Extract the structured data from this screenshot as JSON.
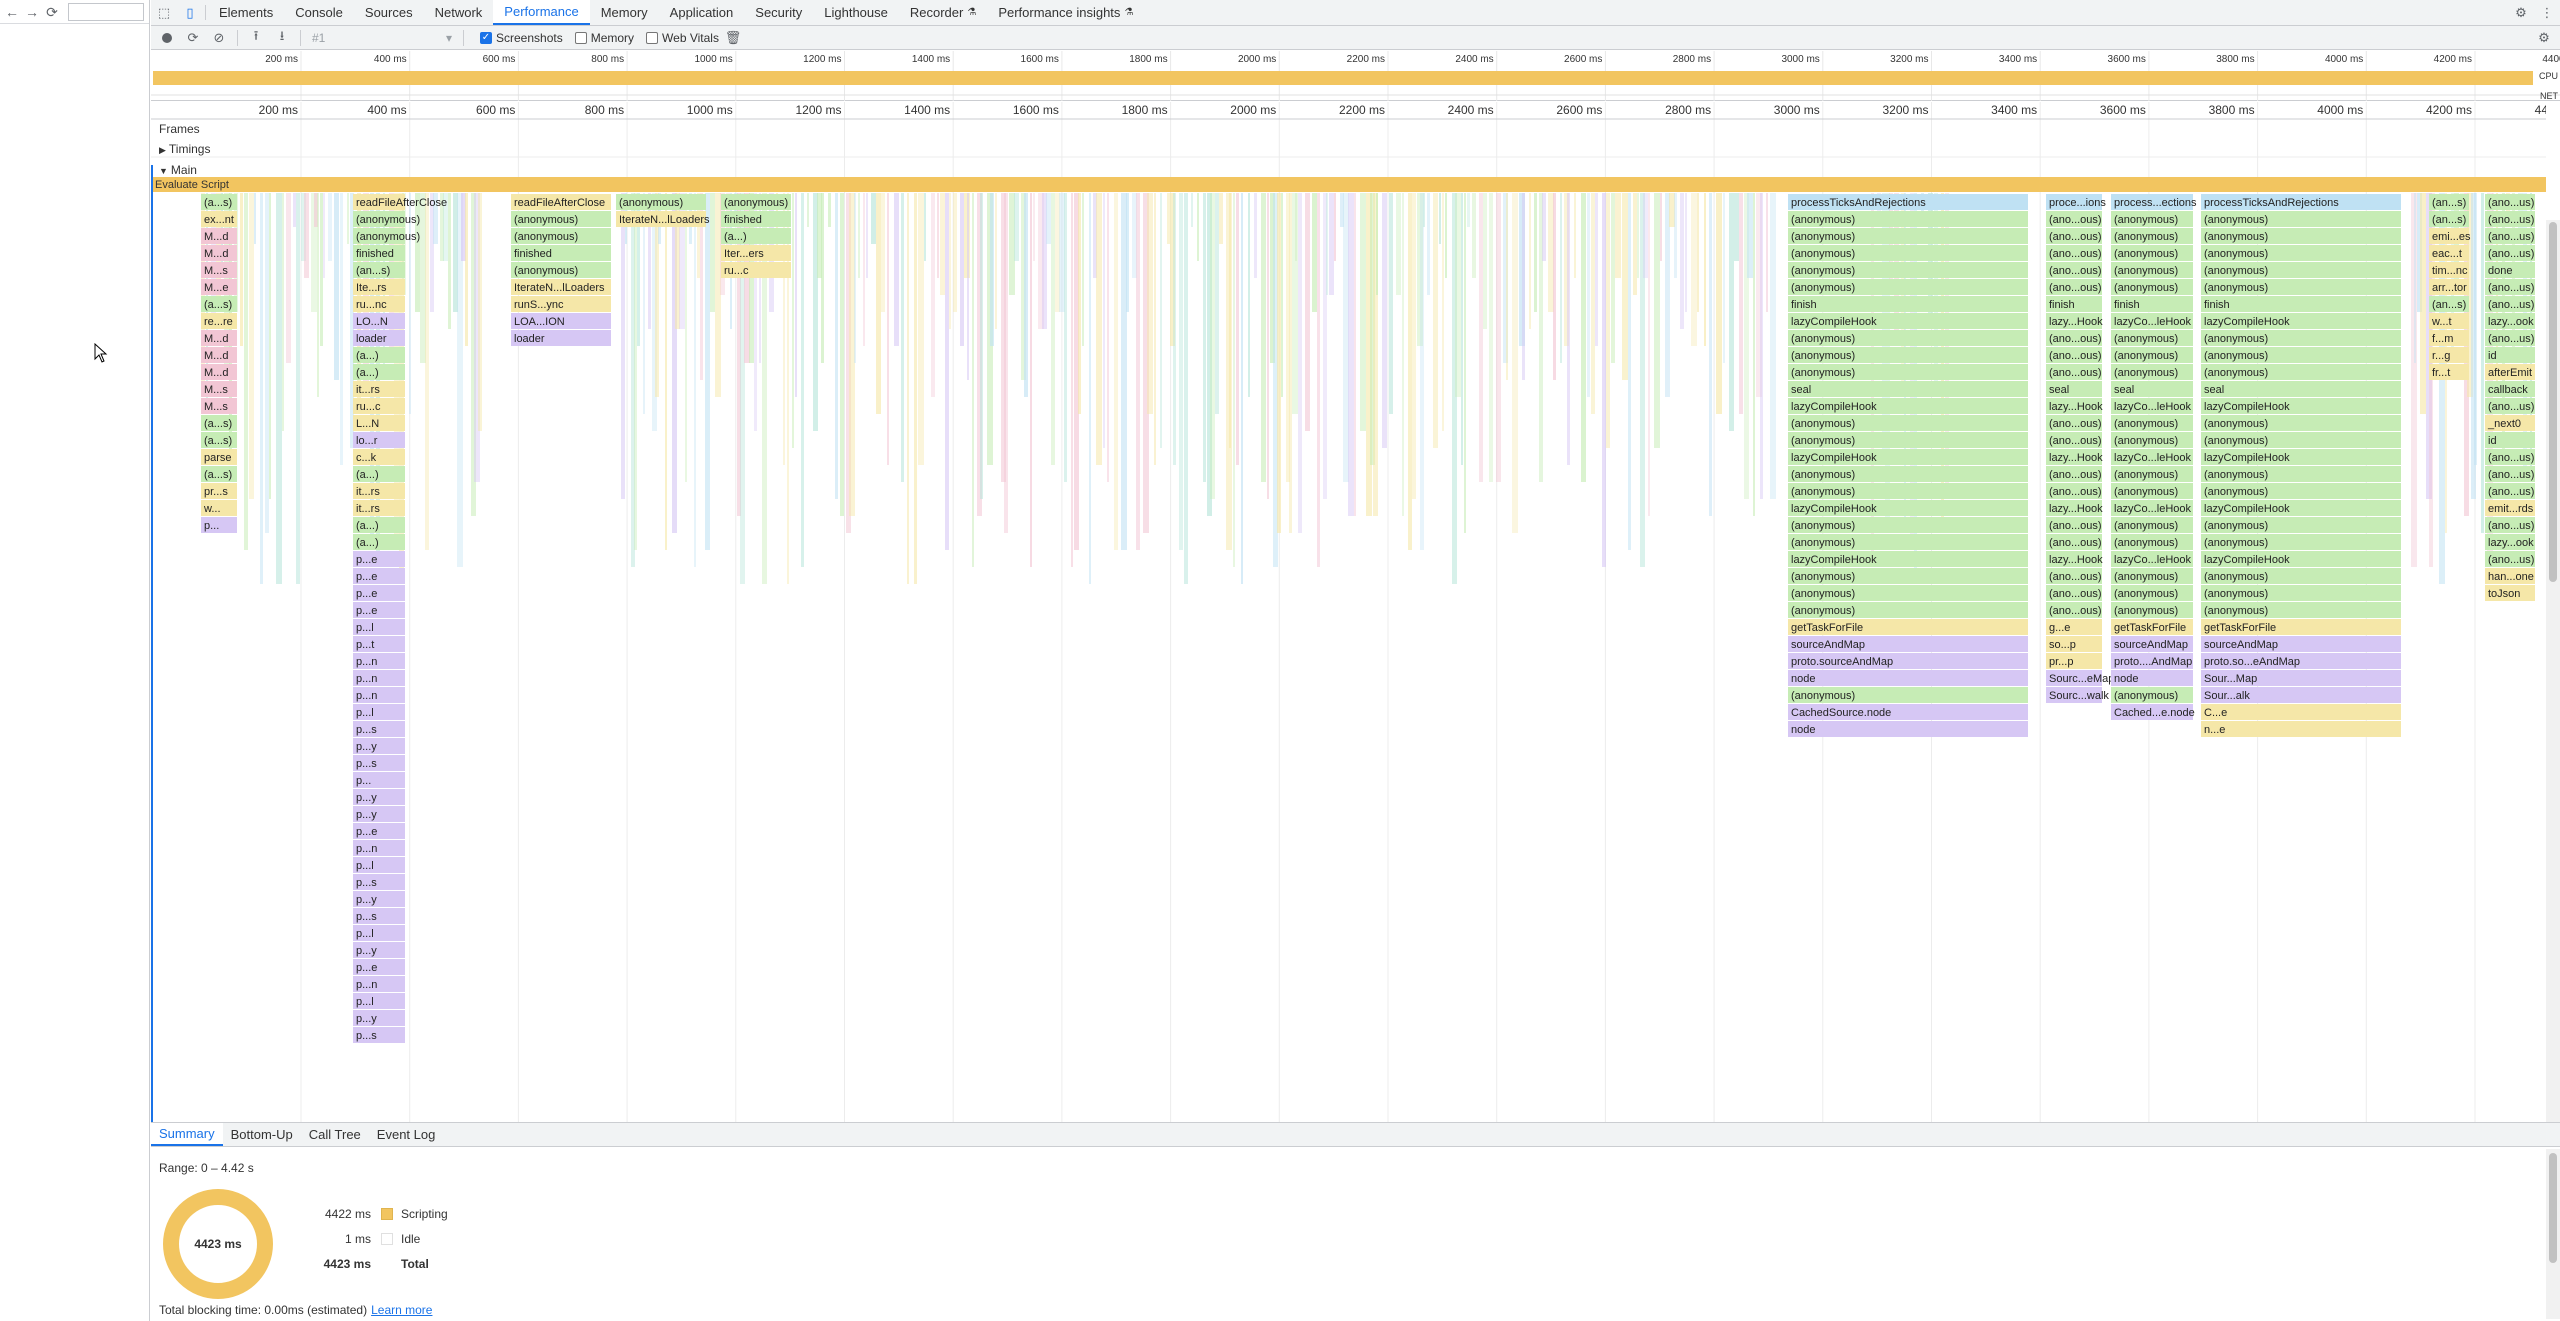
{
  "devtools": {
    "tabs": [
      "Elements",
      "Console",
      "Sources",
      "Network",
      "Performance",
      "Memory",
      "Application",
      "Security",
      "Lighthouse",
      "Recorder",
      "Performance insights"
    ],
    "active_tab": "Performance",
    "toolbar": {
      "profile_select": "#1",
      "screenshots_label": "Screenshots",
      "memory_label": "Memory",
      "web_vitals_label": "Web Vitals",
      "screenshots_checked": true,
      "memory_checked": false,
      "web_vitals_checked": false
    },
    "overview": {
      "ticks": [
        "200 ms",
        "400 ms",
        "600 ms",
        "800 ms",
        "1000 ms",
        "1200 ms",
        "1400 ms",
        "1600 ms",
        "1800 ms",
        "2000 ms",
        "2200 ms",
        "2400 ms",
        "2600 ms",
        "2800 ms",
        "3000 ms",
        "3200 ms",
        "3400 ms",
        "3600 ms",
        "3800 ms",
        "4000 ms",
        "4200 ms",
        "4400 ms"
      ],
      "cpu_label": "CPU",
      "net_label": "NET"
    },
    "tracks": {
      "frames": "Frames",
      "timings": "Timings",
      "main": "Main",
      "evaluate_script": "Evaluate Script"
    },
    "flame_labels": {
      "left_col": [
        "(a...s)",
        "ex...nt",
        "M...d",
        "M...d",
        "M...s",
        "M...e",
        "(a...s)",
        "re...re",
        "M...d",
        "M...d",
        "M...d",
        "M...s",
        "M...s",
        "(a...s)",
        "(a...s)",
        "parse",
        "(a...s)",
        "pr...s",
        "w...",
        "p..."
      ],
      "col_a": [
        "readFileAfterClose",
        "(anonymous)",
        "(anonymous)",
        "finished",
        "(an...s)",
        "Ite...rs",
        "ru...nc",
        "LO...N",
        "loader",
        "(a...)",
        "(a...)",
        "it...rs",
        "ru...c",
        "L...N",
        "lo...r",
        "c...k",
        "(a...)",
        "it...rs",
        "it...rs",
        "(a...)",
        "(a...)",
        "p...e",
        "p...e",
        "p...e",
        "p...e",
        "p...l",
        "p...t",
        "p...n",
        "p...n",
        "p...n",
        "p...l",
        "p...s",
        "p...y",
        "p...s",
        "p...",
        "p...y",
        "p...y",
        "p...e",
        "p...n",
        "p...l",
        "p...s",
        "p...y",
        "p...s",
        "p...l",
        "p...y",
        "p...e",
        "p...n",
        "p...l",
        "p...y",
        "p...s"
      ],
      "col_b": [
        "readFileAfterClose",
        "(anonymous)",
        "(anonymous)",
        "finished",
        "(anonymous)",
        "IterateN...lLoaders",
        "runS...ync",
        "LOA...ION",
        "loader"
      ],
      "col_c": [
        "(anonymous)",
        "IterateN...lLoaders"
      ],
      "col_d": [
        "(anonymous)",
        "finished",
        "(a...)",
        "Iter...ers",
        "ru...c"
      ],
      "col_e": [
        "processTicksAndRejections",
        "(anonymous)",
        "(anonymous)",
        "(anonymous)",
        "(anonymous)",
        "(anonymous)",
        "finish",
        "lazyCompileHook",
        "(anonymous)",
        "(anonymous)",
        "(anonymous)",
        "seal",
        "lazyCompileHook",
        "(anonymous)",
        "(anonymous)",
        "lazyCompileHook",
        "(anonymous)",
        "(anonymous)",
        "lazyCompileHook",
        "(anonymous)",
        "(anonymous)",
        "lazyCompileHook",
        "(anonymous)",
        "(anonymous)",
        "(anonymous)",
        "getTaskForFile",
        "sourceAndMap",
        "proto.sourceAndMap",
        "node",
        "(anonymous)",
        "CachedSource.node",
        "node"
      ],
      "col_f": [
        "proce...ions",
        "(ano...ous)",
        "(ano...ous)",
        "(ano...ous)",
        "(ano...ous)",
        "(ano...ous)",
        "finish",
        "lazy...Hook",
        "(ano...ous)",
        "(ano...ous)",
        "(ano...ous)",
        "seal",
        "lazy...Hook",
        "(ano...ous)",
        "(ano...ous)",
        "lazy...Hook",
        "(ano...ous)",
        "(ano...ous)",
        "lazy...Hook",
        "(ano...ous)",
        "(ano...ous)",
        "lazy...Hook",
        "(ano...ous)",
        "(ano...ous)",
        "(ano...ous)",
        "g...e",
        "so...p",
        "pr...p",
        "Sourc...eMap",
        "Sourc...walk"
      ],
      "col_g": [
        "process...ections",
        "(anonymous)",
        "(anonymous)",
        "(anonymous)",
        "(anonymous)",
        "(anonymous)",
        "finish",
        "lazyCo...leHook",
        "(anonymous)",
        "(anonymous)",
        "(anonymous)",
        "seal",
        "lazyCo...leHook",
        "(anonymous)",
        "(anonymous)",
        "lazyCo...leHook",
        "(anonymous)",
        "(anonymous)",
        "lazyCo...leHook",
        "(anonymous)",
        "(anonymous)",
        "lazyCo...leHook",
        "(anonymous)",
        "(anonymous)",
        "(anonymous)",
        "getTaskForFile",
        "sourceAndMap",
        "proto....AndMap",
        "node",
        "(anonymous)",
        "Cached...e.node"
      ],
      "col_h": [
        "processTicksAndRejections",
        "(anonymous)",
        "(anonymous)",
        "(anonymous)",
        "(anonymous)",
        "(anonymous)",
        "finish",
        "lazyCompileHook",
        "(anonymous)",
        "(anonymous)",
        "(anonymous)",
        "seal",
        "lazyCompileHook",
        "(anonymous)",
        "(anonymous)",
        "lazyCompileHook",
        "(anonymous)",
        "(anonymous)",
        "lazyCompileHook",
        "(anonymous)",
        "(anonymous)",
        "lazyCompileHook",
        "(anonymous)",
        "(anonymous)",
        "(anonymous)",
        "getTaskForFile",
        "sourceAndMap",
        "proto.so...eAndMap",
        "Sour...Map",
        "Sour...alk",
        "C...e",
        "n...e"
      ],
      "col_i": [
        "(an...s)",
        "(an...s)",
        "emi...es",
        "eac...t",
        "tim...nc",
        "arr...tor",
        "(an...s)",
        "w...t",
        "f...m",
        "r...g",
        "fr...t"
      ],
      "col_j": [
        "(ano...us)",
        "(ano...us)",
        "(ano...us)",
        "(ano...us)",
        "done",
        "(ano...us)",
        "(ano...us)",
        "lazy...ook",
        "(ano...us)",
        "id",
        "afterEmit",
        "callback",
        "(ano...us)",
        "_next0",
        "id",
        "(ano...us)",
        "(ano...us)",
        "(ano...us)",
        "emit...rds",
        "(ano...us)",
        "lazy...ook",
        "(ano...us)",
        "han...one",
        "toJson"
      ]
    },
    "bottom": {
      "tabs": [
        "Summary",
        "Bottom-Up",
        "Call Tree",
        "Event Log"
      ],
      "active_tab": "Summary",
      "range": "Range: 0 – 4.42 s",
      "donut_label": "4423 ms",
      "scripting_ms": "4422 ms",
      "scripting_label": "Scripting",
      "idle_ms": "1 ms",
      "idle_label": "Idle",
      "total_ms": "4423 ms",
      "total_label": "Total",
      "footer_text": "Total blocking time: 0.00ms (estimated)",
      "learn_more": "Learn more"
    },
    "colors": {
      "accent": "#1a73e8",
      "scripting": "#f2c560",
      "bar_yellow": "#f5e7a8",
      "bar_green": "#c6ecb5",
      "bar_blue": "#bfe1f3",
      "bar_purple": "#d6c7f4",
      "bar_pink": "#f2c6d4",
      "bar_teal": "#b7e5da"
    }
  }
}
